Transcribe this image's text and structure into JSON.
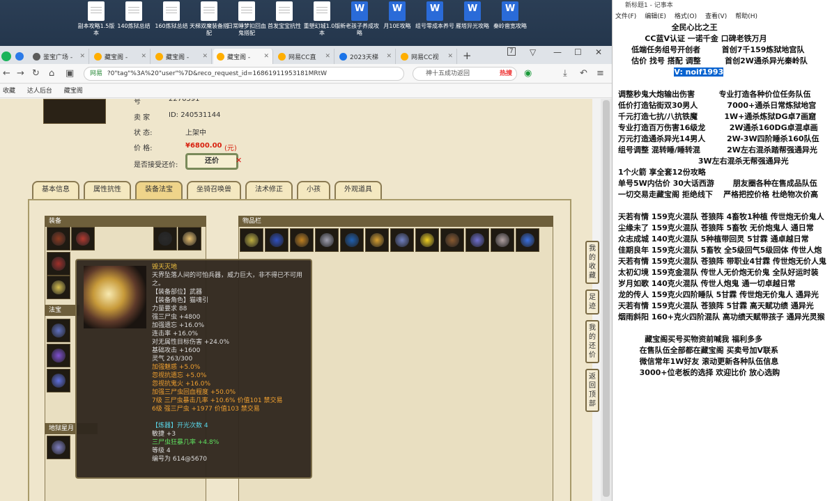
{
  "desktop": {
    "icons": [
      {
        "label": "副本攻略1.5版本",
        "type": "doc"
      },
      {
        "label": "140炼狱总结",
        "type": "doc"
      },
      {
        "label": "160炼狱总结",
        "type": "doc"
      },
      {
        "label": "天梯双魔装备搭配",
        "type": "doc"
      },
      {
        "label": "日常睡梦扣回血鬼搭配",
        "type": "doc"
      },
      {
        "label": "首发宝宝抗性",
        "type": "doc"
      },
      {
        "label": "重塑幻城1.0版本",
        "type": "doc"
      },
      {
        "label": "新老孩子养成攻略",
        "type": "wps"
      },
      {
        "label": "月10E攻略",
        "type": "wps"
      },
      {
        "label": "组号零成本养号",
        "type": "wps"
      },
      {
        "label": "雁塔异光攻略",
        "type": "wps"
      },
      {
        "label": "秦岭凿宽攻略",
        "type": "wps"
      }
    ]
  },
  "browser": {
    "tabs": [
      {
        "label": "鉴宝广场 -",
        "active": false,
        "color": "g"
      },
      {
        "label": "藏宝阁 -",
        "active": false,
        "color": "o"
      },
      {
        "label": "藏宝阁 -",
        "active": false,
        "color": "o"
      },
      {
        "label": "藏宝阁 -",
        "active": true,
        "color": "o"
      },
      {
        "label": "网易CC直",
        "active": false,
        "color": "o"
      },
      {
        "label": "2023天梯",
        "active": false,
        "color": "b"
      },
      {
        "label": "网易CC视",
        "active": false,
        "color": "o"
      }
    ],
    "tab_count": "7",
    "security_label": "网易",
    "url": "?0\"tag\"%3A%20\"user\"%7D&reco_request_id=16861911953181MRtW",
    "search_placeholder": "神十五成功返回",
    "search_hot": "热搜",
    "bookmarks": [
      "收藏",
      "达人后台",
      "藏宝阁"
    ]
  },
  "item_info": {
    "id_label_frag": "号",
    "id_value": "2270591",
    "seller_label": "卖 家",
    "seller_value": "ID: 240531144",
    "status_label": "状 态:",
    "status_value": "上架中",
    "price_label": "价 格:",
    "price_value": "¥6800.00",
    "price_unit": "(元)",
    "bargain_label": "是否接受还价:",
    "bargain_button": "还价"
  },
  "game_tabs": [
    "基本信息",
    "属性抗性",
    "装备法宝",
    "坐骑召唤兽",
    "法术修正",
    "小孩",
    "外观道具"
  ],
  "active_game_tab": "装备法宝",
  "sections": {
    "equipment": "装备",
    "inventory": "物品栏",
    "fabao": "法宝",
    "bottom": "地狱星月"
  },
  "side_buttons": [
    "我的收藏",
    "足迹",
    "我的还价",
    "返回顶部"
  ],
  "tooltip": {
    "name": "毁天灭地",
    "desc": "天界坠落人间的可怕兵器，威力巨大，非不得已不可用之。",
    "slot": "【装备部位】武器",
    "role": "【装备角色】猫魂引",
    "lines": [
      {
        "t": "力量要求 88",
        "c": ""
      },
      {
        "t": "强三尸虫 +4800",
        "c": ""
      },
      {
        "t": "加强遗忘 +16.0%",
        "c": ""
      },
      {
        "t": "连击率 +16.0%",
        "c": ""
      },
      {
        "t": "对无属性目标伤害 +24.0%",
        "c": ""
      },
      {
        "t": "基础攻击 +1600",
        "c": ""
      },
      {
        "t": "灵气 263/300",
        "c": ""
      },
      {
        "t": "加强魅惑 +5.0%",
        "c": "or"
      },
      {
        "t": "忽视抗遗忘 +5.0%",
        "c": "or"
      },
      {
        "t": "忽视抗鬼火 +16.0%",
        "c": "or"
      },
      {
        "t": "加强三尸虫回血程度 +50.0%",
        "c": "or"
      },
      {
        "t": "7级 三尸虫暴击几率 +10.6% 价值101 禁交易",
        "c": "or"
      },
      {
        "t": "6级 强三尸虫 +1977 价值103 禁交易",
        "c": "or"
      }
    ],
    "refine_title": "【炼器】开光次数 4",
    "refine": [
      {
        "t": "敏捷 +3",
        "c": ""
      },
      {
        "t": "三尸虫狂暴几率 +4.8%",
        "c": ""
      },
      {
        "t": "等级 4",
        "c": ""
      },
      {
        "t": "编号为 614@5670",
        "c": ""
      }
    ]
  },
  "notepad": {
    "title": "新标题1 - 记事本",
    "menu": [
      "文件(F)",
      "编辑(E)",
      "格式(O)",
      "查看(V)",
      "帮助(H)"
    ],
    "lines": [
      "                    全民心比之王",
      "          CC蓝V认证 一诺千金 口碑老铁万月",
      "     低端任务组号开创者        首创7千159炼狱地宫队",
      "     估价 找号 搭配 调整         首创2W通杀异光秦岭队",
      "                     V: noif1993",
      "",
      "调整秒鬼大炮输出伤害         专业打造各种价位任务队伍",
      "低价打造钻街双30男人           7000+通杀日常炼狱地宫",
      "千元打造七抗/八抗铁魔          1W+通杀炼狱DG卓7画窟",
      "专业打造百万伤害16级龙         2W通杀160DG卓混卓画",
      "万元打造通杀异光14男人        2W-3W四阶睡杀160队伍",
      "组号调整 混转睡/睡转混          2W左右混杀踏帮强通异光",
      "                              3W左右混杀无帮强通异光",
      "1个火箭 享全套12份攻略",
      "单号5W内估价 30大话西游       朋友圈各种在售成品队伍",
      "一切交易走藏宝阁 拒绝线下    严格把控价格 杜绝物次价高",
      "",
      "天若有情 159克火混队 苍狼阵 4畜牧1种植 传世炮无价鬼人",
      "尘缘未了 159克火混队 苍狼阵 5畜牧 无价炮鬼人 通日常",
      "众志成城 140克火混队 5种植带回灵 5甘霖 通卓越日常",
      "佳期良年 159克火混队 5畜牧 全5级回气5级回体 传世人炮",
      "天若有情 159克火混队 苍狼阵 带职业4甘霖 传世炮无价人鬼",
      "太初幻境 159克金混队 传世人无价炮无价鬼 全队好运时装",
      "岁月如歌 140克火混队 传世人炮鬼 通一切卓越日常",
      "龙的传人 159克火四阶睡队 5甘霖 传世炮无价鬼人 通异光",
      "天若有情 159克火混队 苍狼阵 5甘霖 高天赋功绩 通异光",
      "烟雨斜阳 160+克火四阶混队 高功绩天赋带孩子 通异光灵猴",
      "",
      "          藏宝阁买号买物资前喊我 福利多多",
      "        在售队伍全部都在藏宝阁 买卖号加V联系",
      "        微信常年1W好友 滚动更新各种队伍信息",
      "        3000+位老板的选择 欢迎比价 放心选购"
    ],
    "selected": "V: noif1993"
  }
}
